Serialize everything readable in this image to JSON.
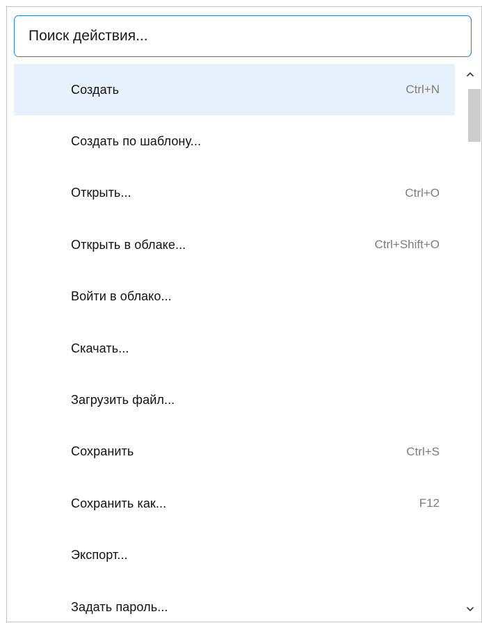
{
  "search": {
    "placeholder": "Поиск действия...",
    "value": ""
  },
  "menu": {
    "items": [
      {
        "label": "Создать",
        "shortcut": "Ctrl+N",
        "highlighted": true
      },
      {
        "label": "Создать по шаблону...",
        "shortcut": ""
      },
      {
        "label": "Открыть...",
        "shortcut": "Ctrl+O"
      },
      {
        "label": "Открыть в облаке...",
        "shortcut": "Ctrl+Shift+O"
      },
      {
        "label": "Войти в облако...",
        "shortcut": ""
      },
      {
        "label": "Скачать...",
        "shortcut": ""
      },
      {
        "label": "Загрузить файл...",
        "shortcut": ""
      },
      {
        "label": "Сохранить",
        "shortcut": "Ctrl+S"
      },
      {
        "label": "Сохранить как...",
        "shortcut": "F12"
      },
      {
        "label": "Экспорт...",
        "shortcut": ""
      },
      {
        "label": "Задать пароль...",
        "shortcut": ""
      }
    ]
  },
  "scrollbar": {
    "up_icon": "chevron-up-icon",
    "down_icon": "chevron-down-icon"
  },
  "colors": {
    "accent": "#1f84d6",
    "highlight": "#e6f1fb",
    "shortcut_text": "#7d7d7d",
    "thumb": "#cdcdcd"
  }
}
